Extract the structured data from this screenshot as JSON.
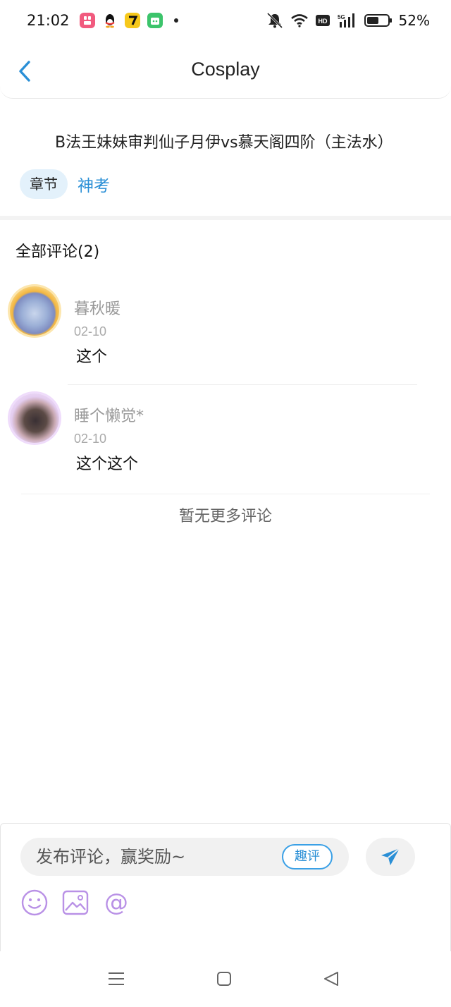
{
  "status_bar": {
    "time": "21:02",
    "battery": "52%",
    "notification_icons": [
      "pink-app-icon",
      "qq-penguin-icon",
      "yellow-app-icon",
      "green-app-icon"
    ],
    "system_icons": [
      "bell-muted-icon",
      "wifi-icon",
      "hd-icon",
      "5g-signal-icon",
      "battery-icon"
    ]
  },
  "header": {
    "title": "Cosplay"
  },
  "post": {
    "title": "B法王妹妹审判仙子月伊vs慕天阁四阶（主法水）",
    "chapter_tag": "章节",
    "tag_link": "神考"
  },
  "comments": {
    "header": "全部评论(2)",
    "items": [
      {
        "username": "暮秋暖",
        "date": "02-10",
        "text": "这个"
      },
      {
        "username": "睡个懒觉*",
        "date": "02-10",
        "text": "这个这个"
      }
    ],
    "no_more": "暂无更多评论"
  },
  "input": {
    "placeholder": "发布评论，赢奖励~",
    "fun_review_label": "趣评",
    "at_symbol": "@"
  },
  "colors": {
    "accent_blue": "#2a8fd6",
    "tag_bg": "#e3f1fb",
    "tool_purple": "#b991e6"
  }
}
